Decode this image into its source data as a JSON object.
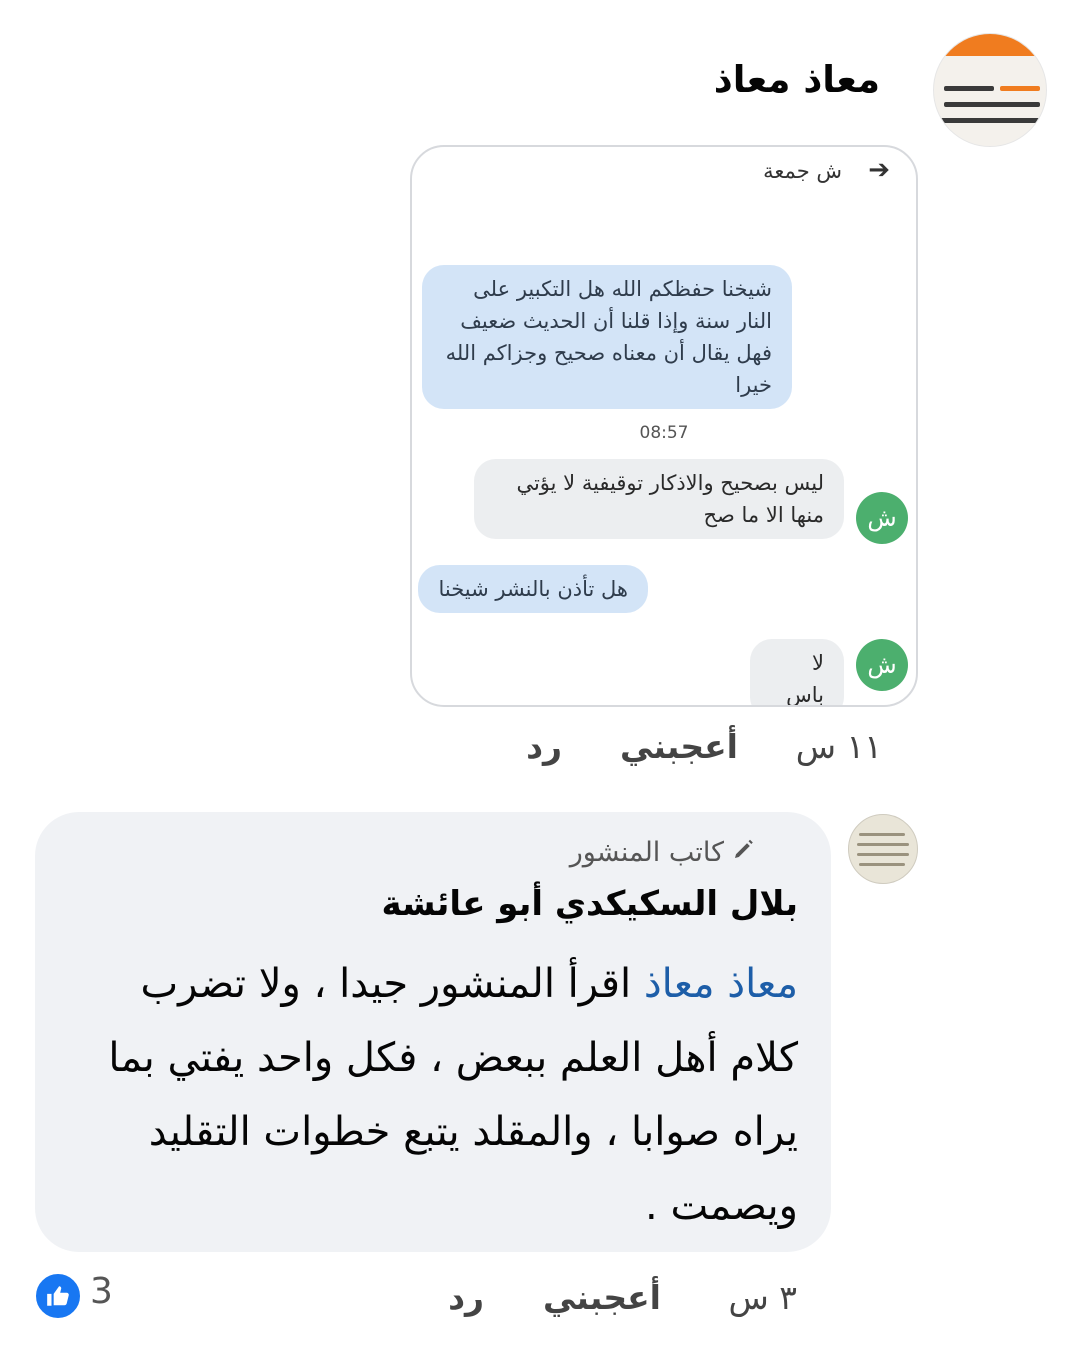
{
  "comment": {
    "author": "معاذ معاذ",
    "avatar_icon": "profile-photo-icon",
    "screenshot": {
      "header_title": "ش جمعة",
      "back_icon": "arrow-right-icon",
      "messages": [
        {
          "text": "شيخنا حفظكم الله هل التكبير على النار سنة وإذا قلنا أن الحديث ضعيف فهل يقال أن معناه صحيح وجزاكم الله خيرا"
        },
        {
          "text": "ليس بصحيح والاذكار توقيفية لا يؤتي منها الا ما صح",
          "avatar": "ش"
        },
        {
          "text": "هل تأذن بالنشر شيخنا"
        },
        {
          "text": "لا باس",
          "avatar": "ش"
        }
      ],
      "timestamp": "08:57"
    },
    "time": "١١ س",
    "like_label": "أعجبني",
    "reply_label": "رد"
  },
  "reply": {
    "author_badge": "كاتب المنشور",
    "badge_icon": "pencil-icon",
    "author": "بلال السكيكدي أبو عائشة",
    "mention": "معاذ معاذ",
    "body": "اقرأ المنشور جيدا ، ولا تضرب كلام أهل العلم ببعض ، فكل واحد يفتي بما يراه صوابا ، والمقلد يتبع خطوات التقليد ويصمت .",
    "time": "٣ س",
    "like_label": "أعجبني",
    "reply_label": "رد",
    "reaction_count": "3",
    "reaction_icon": "thumbs-up-icon"
  },
  "colors": {
    "accent": "#1877f2",
    "mention": "#1d5ea8",
    "bubble_bg": "#f0f2f5"
  }
}
